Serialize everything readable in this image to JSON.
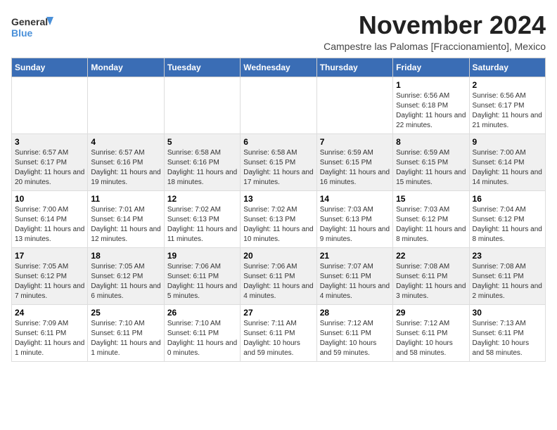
{
  "logo": {
    "line1": "General",
    "line2": "Blue"
  },
  "title": "November 2024",
  "subtitle": "Campestre las Palomas [Fraccionamiento], Mexico",
  "days_of_week": [
    "Sunday",
    "Monday",
    "Tuesday",
    "Wednesday",
    "Thursday",
    "Friday",
    "Saturday"
  ],
  "weeks": [
    [
      {
        "day": "",
        "info": ""
      },
      {
        "day": "",
        "info": ""
      },
      {
        "day": "",
        "info": ""
      },
      {
        "day": "",
        "info": ""
      },
      {
        "day": "",
        "info": ""
      },
      {
        "day": "1",
        "info": "Sunrise: 6:56 AM\nSunset: 6:18 PM\nDaylight: 11 hours and 22 minutes."
      },
      {
        "day": "2",
        "info": "Sunrise: 6:56 AM\nSunset: 6:17 PM\nDaylight: 11 hours and 21 minutes."
      }
    ],
    [
      {
        "day": "3",
        "info": "Sunrise: 6:57 AM\nSunset: 6:17 PM\nDaylight: 11 hours and 20 minutes."
      },
      {
        "day": "4",
        "info": "Sunrise: 6:57 AM\nSunset: 6:16 PM\nDaylight: 11 hours and 19 minutes."
      },
      {
        "day": "5",
        "info": "Sunrise: 6:58 AM\nSunset: 6:16 PM\nDaylight: 11 hours and 18 minutes."
      },
      {
        "day": "6",
        "info": "Sunrise: 6:58 AM\nSunset: 6:15 PM\nDaylight: 11 hours and 17 minutes."
      },
      {
        "day": "7",
        "info": "Sunrise: 6:59 AM\nSunset: 6:15 PM\nDaylight: 11 hours and 16 minutes."
      },
      {
        "day": "8",
        "info": "Sunrise: 6:59 AM\nSunset: 6:15 PM\nDaylight: 11 hours and 15 minutes."
      },
      {
        "day": "9",
        "info": "Sunrise: 7:00 AM\nSunset: 6:14 PM\nDaylight: 11 hours and 14 minutes."
      }
    ],
    [
      {
        "day": "10",
        "info": "Sunrise: 7:00 AM\nSunset: 6:14 PM\nDaylight: 11 hours and 13 minutes."
      },
      {
        "day": "11",
        "info": "Sunrise: 7:01 AM\nSunset: 6:14 PM\nDaylight: 11 hours and 12 minutes."
      },
      {
        "day": "12",
        "info": "Sunrise: 7:02 AM\nSunset: 6:13 PM\nDaylight: 11 hours and 11 minutes."
      },
      {
        "day": "13",
        "info": "Sunrise: 7:02 AM\nSunset: 6:13 PM\nDaylight: 11 hours and 10 minutes."
      },
      {
        "day": "14",
        "info": "Sunrise: 7:03 AM\nSunset: 6:13 PM\nDaylight: 11 hours and 9 minutes."
      },
      {
        "day": "15",
        "info": "Sunrise: 7:03 AM\nSunset: 6:12 PM\nDaylight: 11 hours and 8 minutes."
      },
      {
        "day": "16",
        "info": "Sunrise: 7:04 AM\nSunset: 6:12 PM\nDaylight: 11 hours and 8 minutes."
      }
    ],
    [
      {
        "day": "17",
        "info": "Sunrise: 7:05 AM\nSunset: 6:12 PM\nDaylight: 11 hours and 7 minutes."
      },
      {
        "day": "18",
        "info": "Sunrise: 7:05 AM\nSunset: 6:12 PM\nDaylight: 11 hours and 6 minutes."
      },
      {
        "day": "19",
        "info": "Sunrise: 7:06 AM\nSunset: 6:11 PM\nDaylight: 11 hours and 5 minutes."
      },
      {
        "day": "20",
        "info": "Sunrise: 7:06 AM\nSunset: 6:11 PM\nDaylight: 11 hours and 4 minutes."
      },
      {
        "day": "21",
        "info": "Sunrise: 7:07 AM\nSunset: 6:11 PM\nDaylight: 11 hours and 4 minutes."
      },
      {
        "day": "22",
        "info": "Sunrise: 7:08 AM\nSunset: 6:11 PM\nDaylight: 11 hours and 3 minutes."
      },
      {
        "day": "23",
        "info": "Sunrise: 7:08 AM\nSunset: 6:11 PM\nDaylight: 11 hours and 2 minutes."
      }
    ],
    [
      {
        "day": "24",
        "info": "Sunrise: 7:09 AM\nSunset: 6:11 PM\nDaylight: 11 hours and 1 minute."
      },
      {
        "day": "25",
        "info": "Sunrise: 7:10 AM\nSunset: 6:11 PM\nDaylight: 11 hours and 1 minute."
      },
      {
        "day": "26",
        "info": "Sunrise: 7:10 AM\nSunset: 6:11 PM\nDaylight: 11 hours and 0 minutes."
      },
      {
        "day": "27",
        "info": "Sunrise: 7:11 AM\nSunset: 6:11 PM\nDaylight: 10 hours and 59 minutes."
      },
      {
        "day": "28",
        "info": "Sunrise: 7:12 AM\nSunset: 6:11 PM\nDaylight: 10 hours and 59 minutes."
      },
      {
        "day": "29",
        "info": "Sunrise: 7:12 AM\nSunset: 6:11 PM\nDaylight: 10 hours and 58 minutes."
      },
      {
        "day": "30",
        "info": "Sunrise: 7:13 AM\nSunset: 6:11 PM\nDaylight: 10 hours and 58 minutes."
      }
    ]
  ]
}
